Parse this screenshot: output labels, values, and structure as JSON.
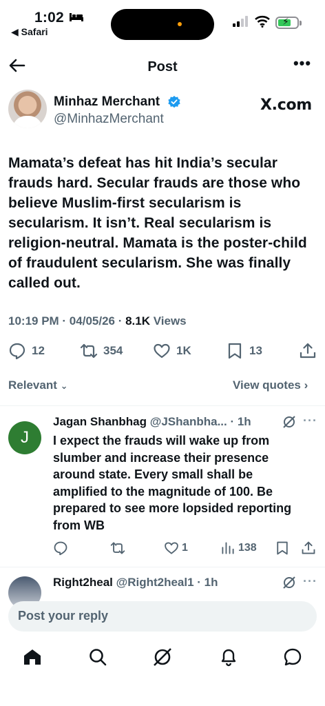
{
  "status_bar": {
    "time": "1:02",
    "back_app": "◀ Safari"
  },
  "nav": {
    "title": "Post",
    "more": "•••"
  },
  "post": {
    "author_name": "Minhaz Merchant",
    "author_handle": "@MinhazMerchant",
    "source_logo_text": "X.com",
    "text": "Mamata’s defeat has hit India’s secular frauds hard. Secular frauds are those who believe Muslim-first secularism is secularism. It isn’t. Real secularism is religion-neutral. Mamata is the poster-child of fraudulent secularism. She was finally called out.",
    "time": "10:19 PM · 04/05/26 · ",
    "views_count": "8.1K",
    "views_label": " Views",
    "replies": "12",
    "reposts": "354",
    "likes": "1K",
    "bookmarks": "13"
  },
  "sort": {
    "relevant_label": "Relevant",
    "view_quotes_label": "View quotes"
  },
  "replies": [
    {
      "avatar_letter": "J",
      "name": "Jagan Shanbhag",
      "handle_time": " @JShanbha... · 1h",
      "more": "···",
      "text": "I expect the frauds will wake up from slumber and increase their presence around state. Every small shall be amplified to the magnitude of 100. Be prepared to see more lopsided reporting from WB",
      "likes": "1",
      "views": "138"
    },
    {
      "name": "Right2heal",
      "handle_time": " @Right2heal1 · 1h",
      "more": "···"
    }
  ],
  "reply_box": {
    "placeholder": "Post your reply"
  },
  "colors": {
    "text": "#0f1419",
    "secondary": "#536471",
    "verified": "#1d9bf0",
    "avatar_j": "#2e7d32"
  },
  "icons": [
    "bed-icon",
    "signal-icon",
    "wifi-icon",
    "battery-icon",
    "back-arrow-icon",
    "verified-icon",
    "reply-icon",
    "repost-icon",
    "like-icon",
    "bookmark-icon",
    "share-icon",
    "views-icon",
    "grok-icon",
    "home-icon",
    "search-icon",
    "notifications-icon",
    "messages-icon"
  ]
}
